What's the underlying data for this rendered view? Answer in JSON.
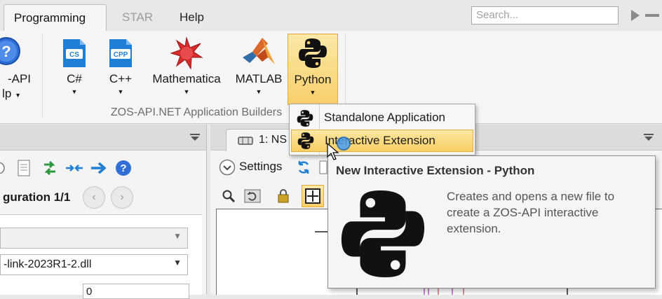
{
  "tabs": {
    "programming": "Programming",
    "star": "STAR",
    "help": "Help"
  },
  "search": {
    "placeholder": "Search..."
  },
  "ribbon": {
    "partial_button_label_line1": "-API",
    "partial_button_label_line2": "lp",
    "buttons": {
      "csharp": {
        "label": "C#",
        "icon_text": "CS"
      },
      "cpp": {
        "label": "C++",
        "icon_text": "CPP"
      },
      "mathematica": {
        "label": "Mathematica"
      },
      "matlab": {
        "label": "MATLAB"
      },
      "python": {
        "label": "Python"
      }
    },
    "group_label": "ZOS-API.NET Application Builders"
  },
  "left_pane": {
    "config_label": "guration 1/1",
    "combo2_value": "-link-2023R1-2.dll",
    "number_value": "0"
  },
  "right_pane": {
    "doc_tab_label": "1: NS",
    "settings_label": "Settings"
  },
  "dropdown": {
    "items": [
      {
        "label": "Standalone Application"
      },
      {
        "label": "Interactive Extension"
      }
    ]
  },
  "tooltip": {
    "title": "New Interactive Extension - Python",
    "description": "Creates and opens a new file to create a ZOS-API interactive extension."
  },
  "colors": {
    "accent_highlight": "#f8cf63",
    "icon_blue": "#1f7fd6",
    "python_black": "#111111"
  }
}
